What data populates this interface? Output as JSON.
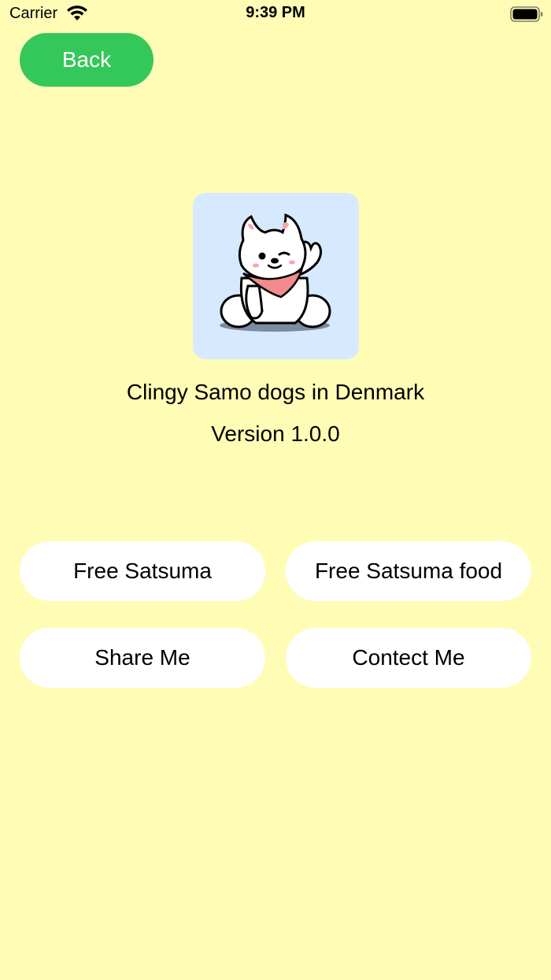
{
  "status_bar": {
    "carrier": "Carrier",
    "time": "9:39 PM"
  },
  "nav": {
    "back_label": "Back"
  },
  "app": {
    "name": "Clingy Samo dogs in Denmark",
    "version": "Version 1.0.0",
    "icon": "samoyed-dog-icon"
  },
  "actions": {
    "free_satsuma": "Free Satsuma",
    "free_satsuma_food": "Free Satsuma food",
    "share_me": "Share Me",
    "contect_me": "Contect Me"
  },
  "colors": {
    "background": "#fffcb6",
    "back_button": "#34c759",
    "icon_background": "#d6e9ff",
    "button_background": "#ffffff"
  }
}
